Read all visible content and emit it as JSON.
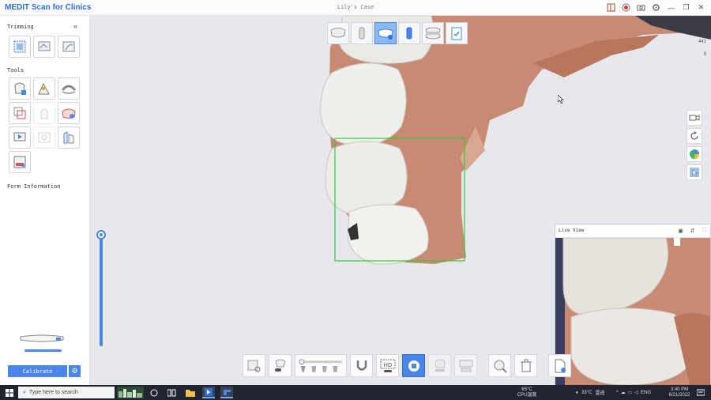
{
  "app": {
    "title": "MEDIT Scan for Clinics",
    "case_title": "Lily's Case"
  },
  "sidebar": {
    "trimming_title": "Trimming",
    "tools_title": "Tools",
    "form_title": "Form Information",
    "calibrate_label": "Calibrate"
  },
  "live_view": {
    "title": "Live View"
  },
  "viewport": {
    "stat_top": "441",
    "stat_bottom": "9"
  },
  "taskbar": {
    "search_placeholder": "Type here to search",
    "temp_value": "65°C",
    "temp_label": "CPU温度",
    "weather": "33°C",
    "weather_desc": "雷遥",
    "lang": "ENG",
    "time": "3:40 PM",
    "date": "6/21/2022"
  },
  "colors": {
    "accent": "#4a86e8",
    "brand": "#2f6fdc",
    "scan_frame": "#33cc33",
    "gingiva": "#c98a74",
    "tooth": "#eceae6"
  }
}
